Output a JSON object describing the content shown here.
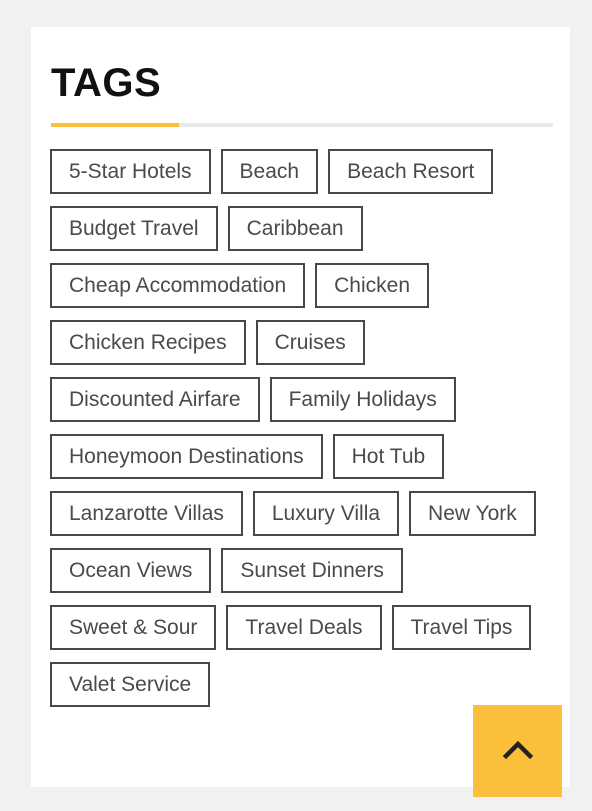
{
  "widget": {
    "title": "TAGS",
    "accent_color": "#fbbf3c",
    "rule_color": "#e9e9e9",
    "card_background": "#ffffff",
    "page_background": "#f1f1f1",
    "tag_border_color": "#484848",
    "tag_text_color": "#4a4a4a"
  },
  "tags": [
    {
      "label": "5-Star Hotels"
    },
    {
      "label": "Beach"
    },
    {
      "label": "Beach Resort"
    },
    {
      "label": "Budget Travel"
    },
    {
      "label": "Caribbean"
    },
    {
      "label": "Cheap Accommodation"
    },
    {
      "label": "Chicken"
    },
    {
      "label": "Chicken Recipes"
    },
    {
      "label": "Cruises"
    },
    {
      "label": "Discounted Airfare"
    },
    {
      "label": "Family Holidays"
    },
    {
      "label": "Honeymoon Destinations"
    },
    {
      "label": "Hot Tub"
    },
    {
      "label": "Lanzarotte Villas"
    },
    {
      "label": "Luxury Villa"
    },
    {
      "label": "New York"
    },
    {
      "label": "Ocean Views"
    },
    {
      "label": "Sunset Dinners"
    },
    {
      "label": "Sweet & Sour"
    },
    {
      "label": "Travel Deals"
    },
    {
      "label": "Travel Tips"
    },
    {
      "label": "Valet Service"
    }
  ],
  "scroll_top_button": {
    "icon": "chevron-up-icon",
    "background_color": "#fbbf3c",
    "icon_color": "#222222"
  }
}
